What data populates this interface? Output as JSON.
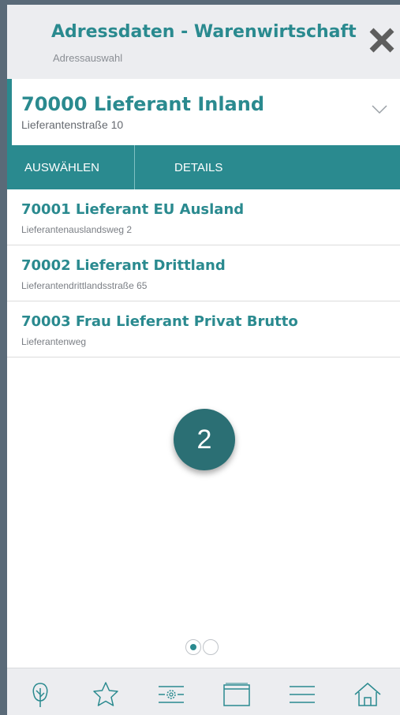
{
  "header": {
    "title": "Adressdaten - Warenwirtschaft",
    "subtitle": "Adressauswahl",
    "close_icon": "close-icon"
  },
  "selected": {
    "title": "70000 Lieferant Inland",
    "address": "Lieferantenstraße 10"
  },
  "actions": {
    "select_label": "AUSWÄHLEN",
    "details_label": "DETAILS"
  },
  "list": [
    {
      "title": "70001 Lieferant EU Ausland",
      "address": "Lieferantenauslandsweg 2"
    },
    {
      "title": "70002 Lieferant Drittland",
      "address": "Lieferantendrittlandsstraße 65"
    },
    {
      "title": "70003 Frau Lieferant Privat Brutto",
      "address": "Lieferantenweg"
    }
  ],
  "badge": {
    "value": "2"
  },
  "pager": {
    "pages": 2,
    "current": 1
  },
  "bottom_nav": [
    "tree-icon",
    "star-icon",
    "settings-panel-icon",
    "window-icon",
    "menu-icon",
    "home-icon"
  ],
  "colors": {
    "accent": "#2a8a8f",
    "badge": "#2b6f74",
    "frame": "#5a6a78"
  }
}
